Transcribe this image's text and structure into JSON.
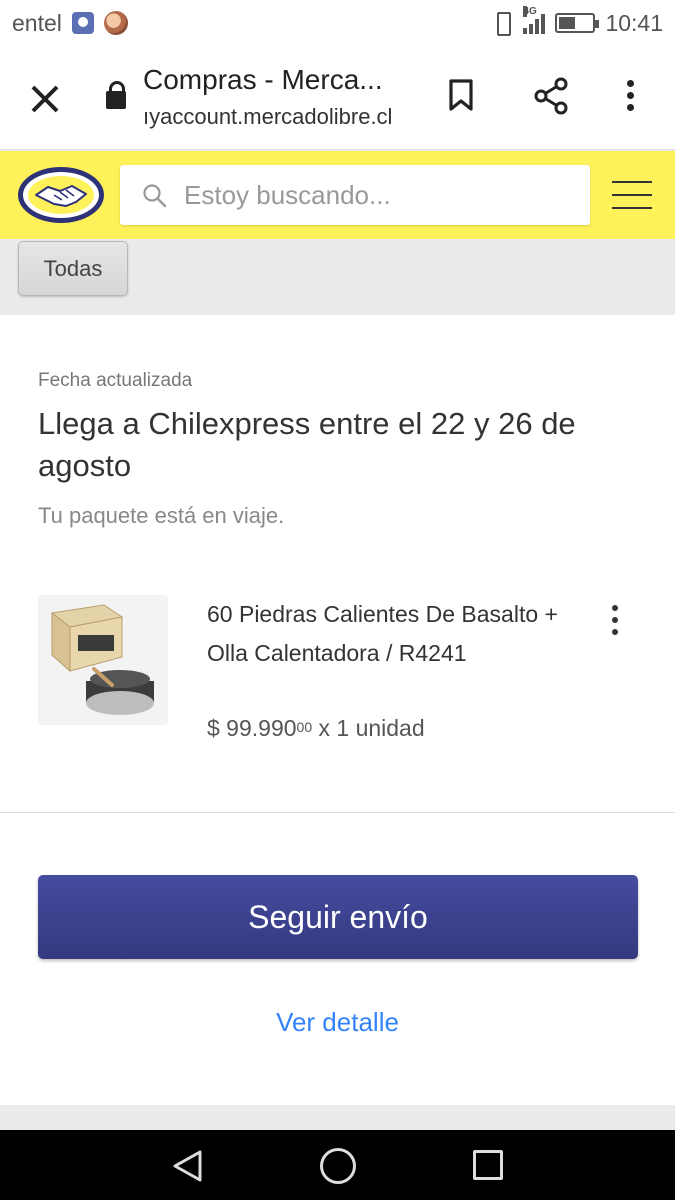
{
  "status_bar": {
    "carrier": "entel",
    "network": "4G",
    "time": "10:41",
    "icons": [
      "app-notification-icon",
      "avatar-notification-icon",
      "vibrate-icon",
      "signal-icon",
      "battery-icon"
    ]
  },
  "browser": {
    "page_title": "Compras - Merca...",
    "url": "ıyaccount.mercadolibre.cl",
    "icons": [
      "close-icon",
      "lock-icon",
      "bookmark-icon",
      "share-icon",
      "menu-dots-icon"
    ]
  },
  "header": {
    "search_placeholder": "Estoy buscando...",
    "accent_color": "#fff159",
    "icons": [
      "mercadolibre-logo",
      "search-icon",
      "hamburger-icon"
    ]
  },
  "filter": {
    "chip_label": "Todas"
  },
  "shipment": {
    "date_label": "Fecha actualizada",
    "headline": "Llega a Chilexpress entre el 22 y 26 de agosto",
    "status_text": "Tu paquete está en viaje."
  },
  "item": {
    "title": "60 Piedras Calientes De Basalto + Olla Calentadora / R4241",
    "price_main": "$ 99.990",
    "price_cents": "00",
    "quantity_text": "x 1 unidad"
  },
  "actions": {
    "primary_label": "Seguir envío",
    "primary_color": "#3a3f8f",
    "link_label": "Ver detalle",
    "link_color": "#3483fa"
  },
  "nav": {
    "icons": [
      "back-icon",
      "home-icon",
      "recents-icon"
    ]
  }
}
